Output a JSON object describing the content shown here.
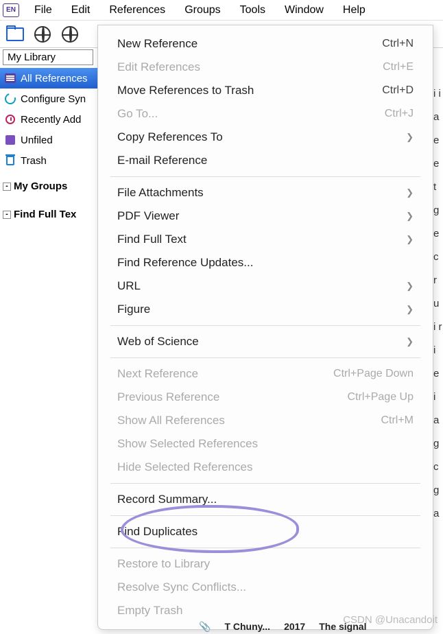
{
  "app_icon_text": "EN",
  "menubar": [
    "File",
    "Edit",
    "References",
    "Groups",
    "Tools",
    "Window",
    "Help"
  ],
  "library_tab": "My Library",
  "sidebar": {
    "items": [
      {
        "label": "All References",
        "selected": true,
        "icon": "allref"
      },
      {
        "label": "Configure Syn",
        "icon": "sync"
      },
      {
        "label": "Recently Add",
        "icon": "clock"
      },
      {
        "label": "Unfiled",
        "icon": "unfiled"
      },
      {
        "label": "Trash",
        "icon": "trash"
      }
    ],
    "groups": [
      {
        "label": "My Groups",
        "expand": "-"
      },
      {
        "label": "Find Full Tex",
        "expand": "-"
      }
    ]
  },
  "dropdown": {
    "sections": [
      [
        {
          "label": "New Reference",
          "shortcut": "Ctrl+N",
          "disabled": false
        },
        {
          "label": "Edit References",
          "shortcut": "Ctrl+E",
          "disabled": true
        },
        {
          "label": "Move References to Trash",
          "shortcut": "Ctrl+D",
          "disabled": false
        },
        {
          "label": "Go To...",
          "shortcut": "Ctrl+J",
          "disabled": true
        },
        {
          "label": "Copy References To",
          "submenu": true,
          "disabled": false
        },
        {
          "label": "E-mail Reference",
          "disabled": false
        }
      ],
      [
        {
          "label": "File Attachments",
          "submenu": true,
          "disabled": false
        },
        {
          "label": "PDF Viewer",
          "submenu": true,
          "disabled": false
        },
        {
          "label": "Find Full Text",
          "submenu": true,
          "disabled": false
        },
        {
          "label": "Find Reference Updates...",
          "disabled": false
        },
        {
          "label": "URL",
          "submenu": true,
          "disabled": false
        },
        {
          "label": "Figure",
          "submenu": true,
          "disabled": false
        }
      ],
      [
        {
          "label": "Web of Science",
          "submenu": true,
          "disabled": false
        }
      ],
      [
        {
          "label": "Next Reference",
          "shortcut": "Ctrl+Page Down",
          "disabled": true
        },
        {
          "label": "Previous Reference",
          "shortcut": "Ctrl+Page Up",
          "disabled": true
        },
        {
          "label": "Show All References",
          "shortcut": "Ctrl+M",
          "disabled": true
        },
        {
          "label": "Show Selected References",
          "disabled": true
        },
        {
          "label": "Hide Selected References",
          "disabled": true
        }
      ],
      [
        {
          "label": "Record Summary...",
          "disabled": false
        }
      ],
      [
        {
          "label": "Find Duplicates",
          "disabled": false
        }
      ],
      [
        {
          "label": "Restore to Library",
          "disabled": true
        },
        {
          "label": "Resolve Sync Conflicts...",
          "disabled": true
        },
        {
          "label": "Empty Trash",
          "disabled": true
        }
      ]
    ]
  },
  "watermark": "CSDN @Unacandoit",
  "bg_row": {
    "author": "T  Chuny...",
    "year": "2017",
    "title": "The signal"
  }
}
